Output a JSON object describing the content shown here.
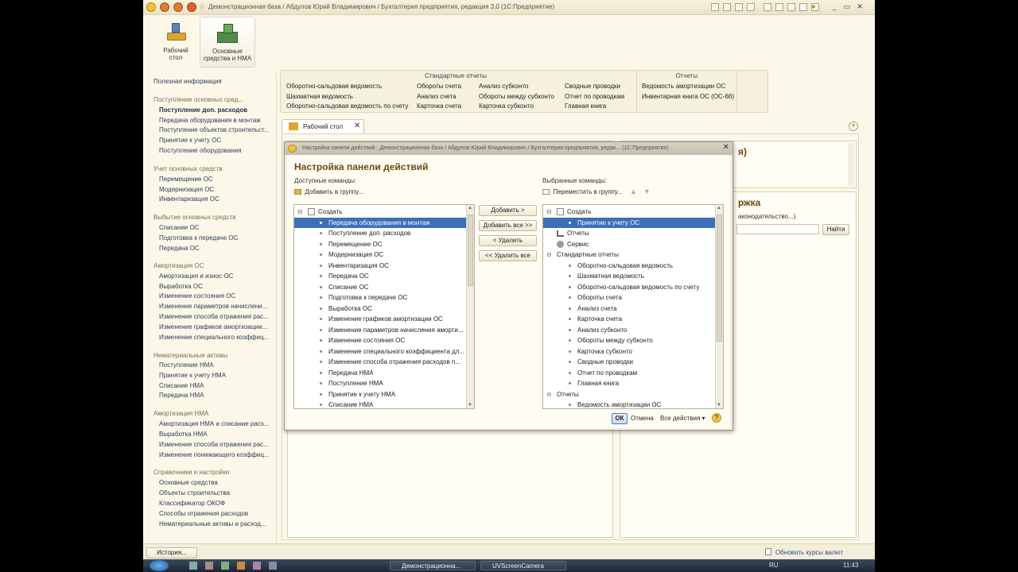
{
  "window": {
    "title": "Демонстрационная база / Абдулов Юрий Владимирович / Бухгалтерия предприятия, редакция 3.0  (1С:Предприятие)"
  },
  "sections": [
    {
      "label": "Рабочий стол",
      "icon": "desktop-icon"
    },
    {
      "label": "Основные средства и НМА",
      "icon": "fixed-assets-icon"
    }
  ],
  "nav": {
    "info": "Полезная информация",
    "groups": [
      {
        "title": "Поступление основных сред...",
        "items": [
          "Поступление доп. расходов",
          "Передача оборудования в монтаж",
          "Поступление объектов строительст...",
          "Принятие к учету ОС",
          "Поступление оборудования"
        ]
      },
      {
        "title": "Учет основных средств",
        "items": [
          "Перемещение ОС",
          "Модернизация ОС",
          "Инвентаризация ОС"
        ]
      },
      {
        "title": "Выбытие основных средств",
        "items": [
          "Списание ОС",
          "Подготовка к передаче ОС",
          "Передача ОС"
        ]
      },
      {
        "title": "Амортизация ОС",
        "items": [
          "Амортизация и износ ОС",
          "Выработка ОС",
          "Изменение состояния ОС",
          "Изменение параметров начислени...",
          "Изменение способа отражения рас...",
          "Изменение графиков амортизации...",
          "Изменение специального коэффиц..."
        ]
      },
      {
        "title": "Нематериальные активы",
        "items": [
          "Поступление НМА",
          "Принятие к учету НМА",
          "Списание НМА",
          "Передача НМА"
        ]
      },
      {
        "title": "Амортизация НМА",
        "items": [
          "Амортизация НМА и списание расх...",
          "Выработка НМА",
          "Изменение способа отражения рас...",
          "Изменение понижающего коэффиц..."
        ]
      },
      {
        "title": "Справочники и настройки",
        "items": [
          "Основные средства",
          "Объекты строительства",
          "Классификатор ОКОФ",
          "Способы отражения расходов",
          "Нематериальные активы и расход..."
        ]
      }
    ]
  },
  "reports": {
    "std_caption": "Стандартные отчеты",
    "std_col1": [
      "Оборотно-сальдовая ведомость",
      "Шахматная ведомость",
      "Оборотно-сальдовая ведомость по счету"
    ],
    "std_col2": [
      "Обороты счета",
      "Анализ счета",
      "Карточка счета"
    ],
    "std_col3": [
      "Анализ субконто",
      "Обороты между субконто",
      "Карточка субконто"
    ],
    "std_col4": [
      "Сводные проводки",
      "Отчет по проводкам",
      "Главная книга"
    ],
    "rep_caption": "Отчеты",
    "rep_items": [
      "Ведомость амортизации ОС",
      "Инвентарная книга ОС (ОС-6б)"
    ]
  },
  "desk_tab": "Рабочий стол",
  "bg": {
    "right_title_frag": "я)",
    "right_title2_frag": "ржка",
    "right_link_frag": "аконодательство...)",
    "find_button": "Найти"
  },
  "dialog": {
    "title": "Настройка панели действий : Демонстрационная база / Абдулов Юрий Владимирович / Бухгалтерия предприятия, редак...  (1С:Предприятие)",
    "heading": "Настройка панели действий",
    "available_label": "Доступные команды:",
    "selected_label": "Выбранные команды:",
    "add_to_group": "Добавить в группу...",
    "move_to_group": "Переместить в группу...",
    "available": {
      "group": "Создать",
      "items": [
        "Передача оборудования в монтаж",
        "Поступление доп. расходов",
        "Перемещение ОС",
        "Модернизация ОС",
        "Инвентаризация ОС",
        "Передача ОС",
        "Списание ОС",
        "Подготовка к передаче ОС",
        "Выработка ОС",
        "Изменение графиков амортизации ОС",
        "Изменение параметров начисления аморти...",
        "Изменение состояния ОС",
        "Изменение специального коэффициента дл...",
        "Изменение способа отражения расходов п...",
        "Передача НМА",
        "Поступление НМА",
        "Принятие к учету НМА",
        "Списание НМА"
      ]
    },
    "selected": {
      "create": "Создать",
      "create_item": "Принятие к учету ОС",
      "reports": "Отчеты",
      "service": "Сервис",
      "std_reports": "Стандартные отчеты",
      "std_items": [
        "Оборотно-сальдовая ведомость",
        "Шахматная ведомость",
        "Оборотно-сальдовая ведомость по счету",
        "Обороты счета",
        "Анализ счета",
        "Карточка счета",
        "Анализ субконто",
        "Обороты между субконто",
        "Карточка субконто",
        "Сводные проводки",
        "Отчет по проводкам",
        "Главная книга"
      ],
      "reports2": "Отчеты",
      "reports2_item": "Ведомость амортизации ОС"
    },
    "btn_add": "Добавить >",
    "btn_add_all": "Добавить все >>",
    "btn_remove": "< Удалить",
    "btn_remove_all": "<< Удалить все",
    "ok": "ОК",
    "cancel": "Отмена",
    "all_actions": "Все действия ▾",
    "help": "?"
  },
  "status": {
    "history": "История...",
    "update_rates": "Обновить курсы валют"
  },
  "taskbar": {
    "items": [
      "Демонстрационна...",
      "UVScreenCamera"
    ],
    "lang": "RU",
    "time": "11:43"
  },
  "colors": {
    "app_bg": "#fbf8ea",
    "selection": "#3d6fb6",
    "heading": "#6b4a10"
  }
}
